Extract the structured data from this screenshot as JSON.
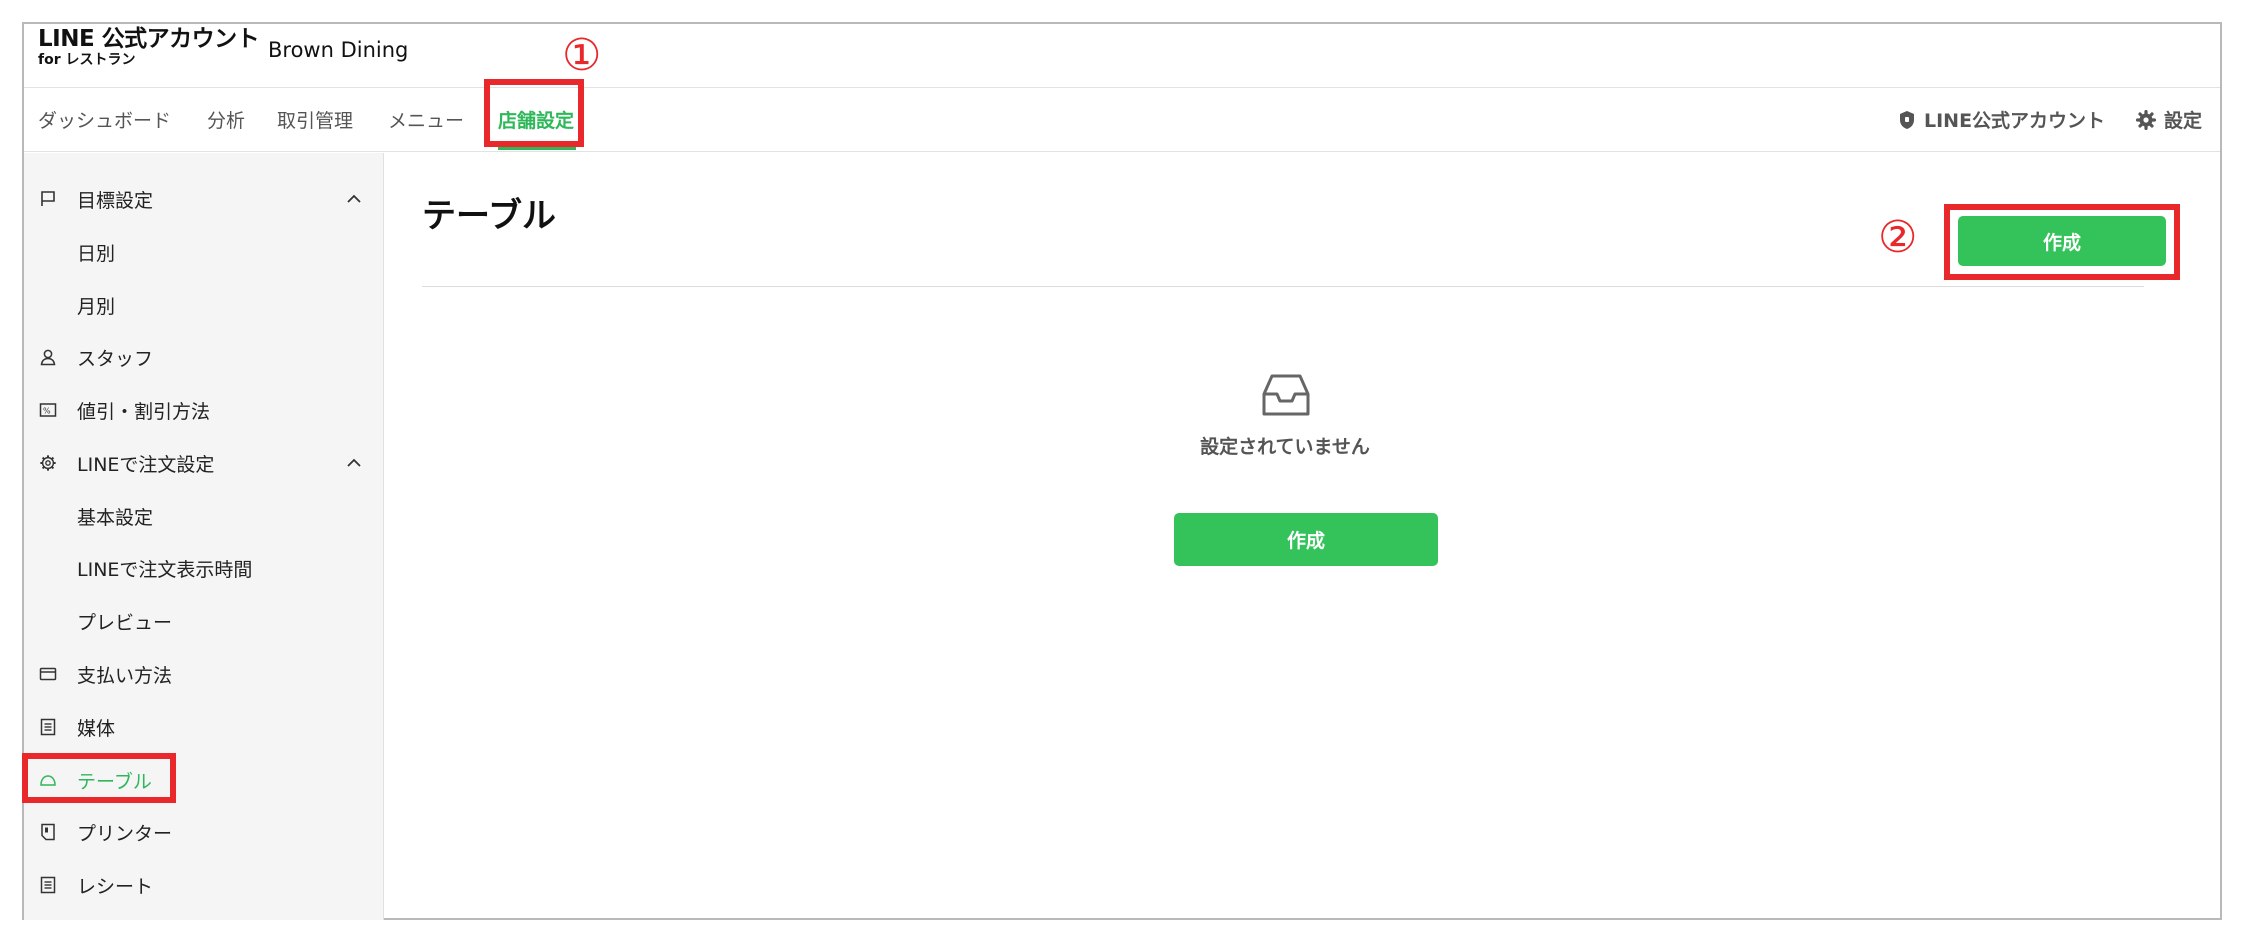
{
  "header": {
    "logo_line1": "LINE 公式アカウント",
    "logo_line2": "for レストラン",
    "shop_name": "Brown Dining"
  },
  "nav": {
    "items": [
      "ダッシュボード",
      "分析",
      "取引管理",
      "メニュー",
      "店舗設定"
    ],
    "active": "店舗設定",
    "right": {
      "account_label": "LINE公式アカウント",
      "settings_label": "設定"
    }
  },
  "sidebar": {
    "items": [
      {
        "label": "目標設定",
        "icon": "flag-icon",
        "expandable": true
      },
      {
        "label": "日別",
        "sub": true
      },
      {
        "label": "月別",
        "sub": true
      },
      {
        "label": "スタッフ",
        "icon": "person-icon"
      },
      {
        "label": "値引・割引方法",
        "icon": "discount-icon"
      },
      {
        "label": "LINEで注文設定",
        "icon": "gear-icon",
        "expandable": true
      },
      {
        "label": "基本設定",
        "sub": true
      },
      {
        "label": "LINEで注文表示時間",
        "sub": true
      },
      {
        "label": "プレビュー",
        "sub": true
      },
      {
        "label": "支払い方法",
        "icon": "card-icon"
      },
      {
        "label": "媒体",
        "icon": "list-icon"
      },
      {
        "label": "テーブル",
        "icon": "dome-icon",
        "active": true
      },
      {
        "label": "プリンター",
        "icon": "printer-icon"
      },
      {
        "label": "レシート",
        "icon": "receipt-icon"
      }
    ]
  },
  "main": {
    "title": "テーブル",
    "create_button": "作成",
    "empty_text": "設定されていません",
    "empty_create_button": "作成"
  },
  "annotations": {
    "step1": "①",
    "step2": "②"
  },
  "colors": {
    "accent": "#33c35a",
    "annotation": "#e8282a"
  }
}
